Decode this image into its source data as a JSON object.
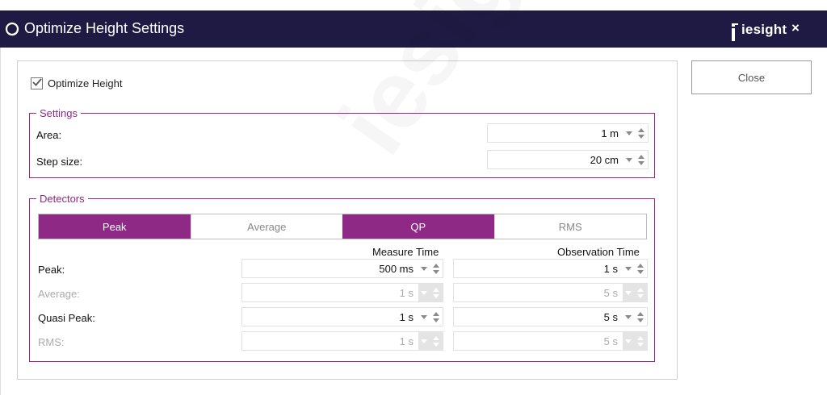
{
  "window": {
    "title": "Optimize Height Settings",
    "brand": "iesight",
    "close_glyph": "×"
  },
  "sidebar": {
    "close_label": "Close"
  },
  "optimize": {
    "label": "Optimize Height",
    "checked": true
  },
  "settings": {
    "legend": "Settings",
    "rows": [
      {
        "label": "Area:",
        "value": "1 m"
      },
      {
        "label": "Step size:",
        "value": "20 cm"
      }
    ]
  },
  "detectors": {
    "legend": "Detectors",
    "tabs": [
      {
        "label": "Peak",
        "active": true
      },
      {
        "label": "Average",
        "active": false
      },
      {
        "label": "QP",
        "active": true
      },
      {
        "label": "RMS",
        "active": false
      }
    ],
    "col_measure": "Measure Time",
    "col_observation": "Observation Time",
    "rows": [
      {
        "label": "Peak:",
        "measure": "500 ms",
        "observation": "1 s",
        "enabled": true
      },
      {
        "label": "Average:",
        "measure": "1 s",
        "observation": "5 s",
        "enabled": false
      },
      {
        "label": "Quasi Peak:",
        "measure": "1 s",
        "observation": "5 s",
        "enabled": true
      },
      {
        "label": "RMS:",
        "measure": "1 s",
        "observation": "5 s",
        "enabled": false
      }
    ]
  },
  "colors": {
    "titlebar": "#1f1a44",
    "accent": "#8e2a86"
  }
}
